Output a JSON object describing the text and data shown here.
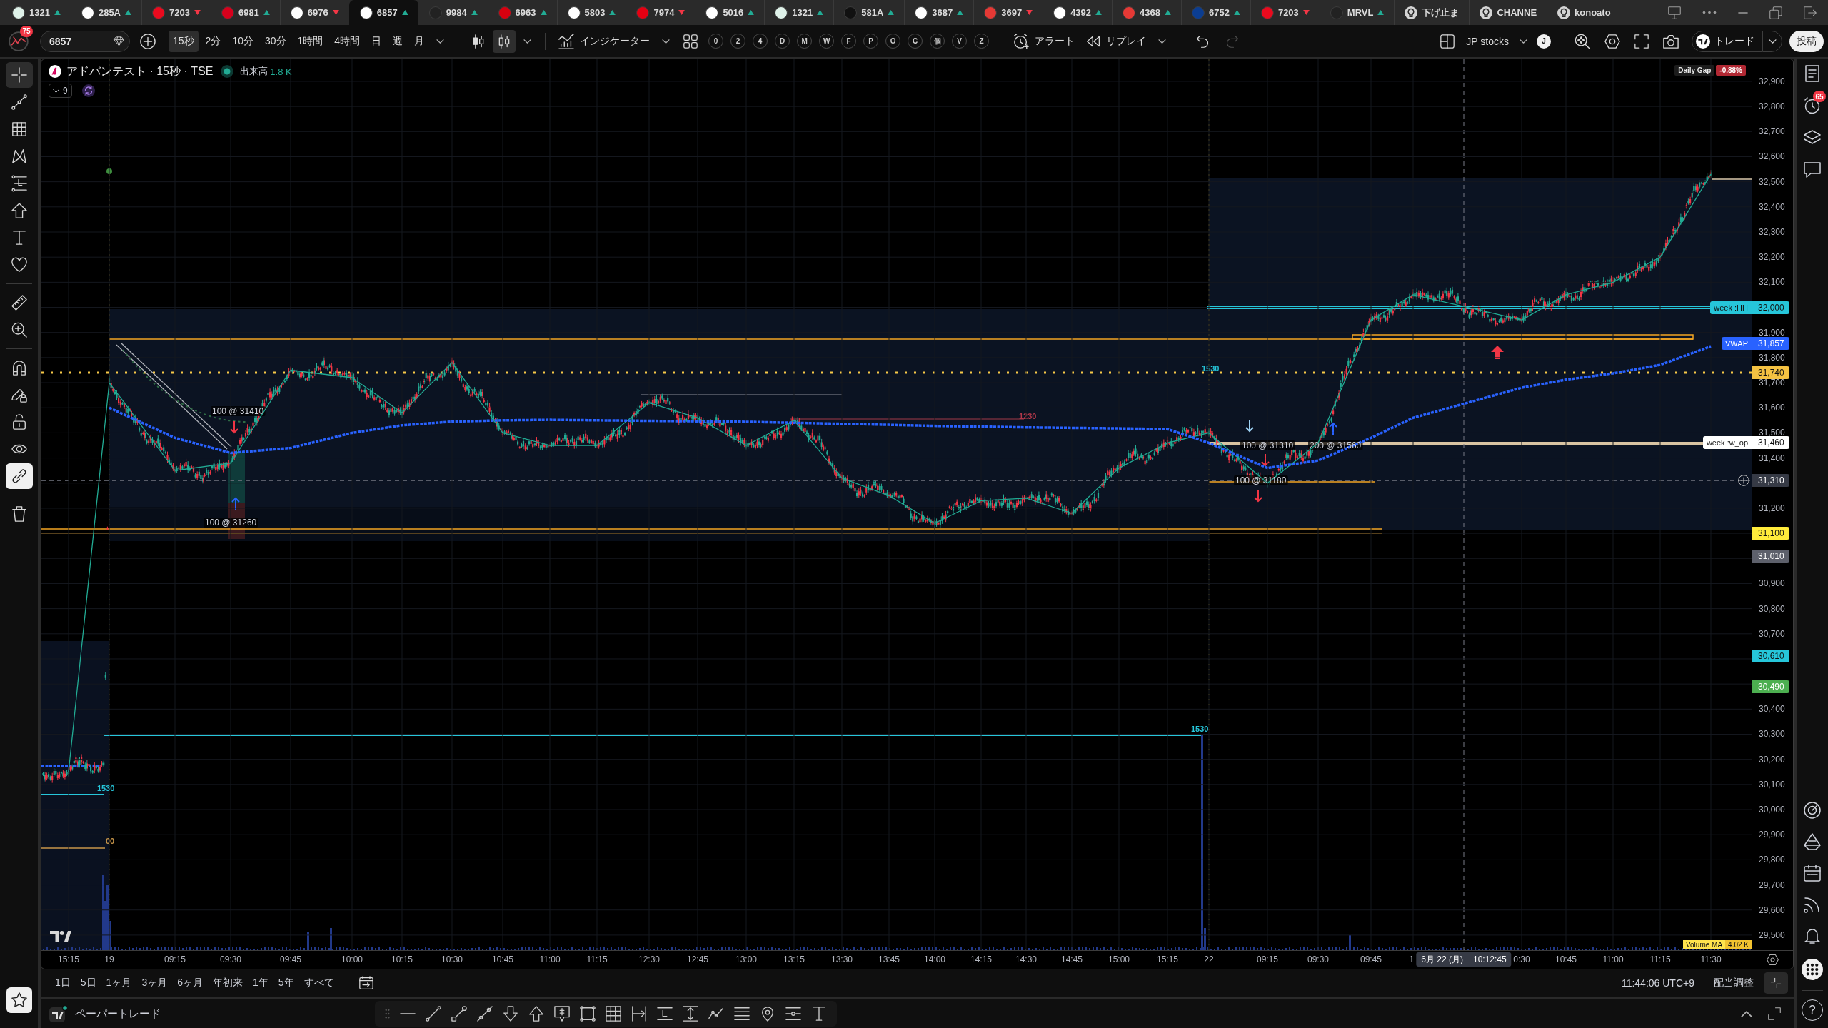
{
  "tabs": [
    {
      "kind": "symbol",
      "symbol": "1321",
      "color": "#dff2e9",
      "up": true,
      "selected": false
    },
    {
      "kind": "symbol",
      "symbol": "285A",
      "color": "#ffffff",
      "up": true,
      "selected": false
    },
    {
      "kind": "symbol",
      "symbol": "7203",
      "color": "#eb0a1e",
      "up": false,
      "selected": false
    },
    {
      "kind": "symbol",
      "symbol": "6981",
      "color": "#d6001c",
      "up": true,
      "selected": false
    },
    {
      "kind": "symbol",
      "symbol": "6976",
      "color": "#ffffff",
      "up": false,
      "selected": false
    },
    {
      "kind": "symbol",
      "symbol": "6857",
      "color": "#ffffff",
      "up": true,
      "selected": true
    },
    {
      "kind": "symbol",
      "symbol": "9984",
      "color": "#222222",
      "up": true,
      "selected": false
    },
    {
      "kind": "symbol",
      "symbol": "6963",
      "color": "#d7000f",
      "up": true,
      "selected": false
    },
    {
      "kind": "symbol",
      "symbol": "5803",
      "color": "#ffffff",
      "up": true,
      "selected": false
    },
    {
      "kind": "symbol",
      "symbol": "7974",
      "color": "#e60012",
      "up": false,
      "selected": false
    },
    {
      "kind": "symbol",
      "symbol": "5016",
      "color": "#ffffff",
      "up": true,
      "selected": false
    },
    {
      "kind": "symbol",
      "symbol": "1321",
      "color": "#dff2e9",
      "up": true,
      "selected": false
    },
    {
      "kind": "symbol",
      "symbol": "581A",
      "color": "#111111",
      "up": true,
      "selected": false
    },
    {
      "kind": "symbol",
      "symbol": "3687",
      "color": "#ffffff",
      "up": true,
      "selected": false
    },
    {
      "kind": "symbol",
      "symbol": "3697",
      "color": "#e53935",
      "up": false,
      "selected": false
    },
    {
      "kind": "symbol",
      "symbol": "4392",
      "color": "#ffffff",
      "up": true,
      "selected": false
    },
    {
      "kind": "symbol",
      "symbol": "4368",
      "color": "#e53935",
      "up": true,
      "selected": false
    },
    {
      "kind": "symbol",
      "symbol": "6752",
      "color": "#0b3d91",
      "up": true,
      "selected": false
    },
    {
      "kind": "symbol",
      "symbol": "7203",
      "color": "#eb0a1e",
      "up": false,
      "selected": false
    },
    {
      "kind": "symbol",
      "symbol": "MRVL",
      "color": "#222222",
      "up": true,
      "selected": false
    },
    {
      "kind": "idea",
      "symbol": "下げ止ま",
      "selected": false
    },
    {
      "kind": "idea",
      "symbol": "CHANNE",
      "selected": false
    },
    {
      "kind": "idea",
      "symbol": "konoato",
      "selected": false
    }
  ],
  "toolbar": {
    "notifications": "75",
    "symbol": "6857",
    "intervals": [
      {
        "label": "15秒",
        "selected": true
      },
      {
        "label": "2分",
        "selected": false
      },
      {
        "label": "10分",
        "selected": false
      },
      {
        "label": "30分",
        "selected": false
      },
      {
        "label": "1時間",
        "selected": false
      },
      {
        "label": "4時間",
        "selected": false
      },
      {
        "label": "日",
        "selected": false
      },
      {
        "label": "週",
        "selected": false
      },
      {
        "label": "月",
        "selected": false
      }
    ],
    "chart_styles": [
      {
        "kind": "candles",
        "selected": false
      },
      {
        "kind": "hollow-candles",
        "selected": true
      }
    ],
    "indicators": "インジケーター",
    "hotkeys": [
      "0",
      "2",
      "4",
      "D",
      "M",
      "W",
      "F",
      "P",
      "O",
      "C",
      "個",
      "V",
      "Z"
    ],
    "alert": "アラート",
    "replay": "リプレイ",
    "history": [
      {
        "kind": "undo",
        "disabled": false
      },
      {
        "kind": "redo",
        "disabled": true
      }
    ],
    "watchlist": "JP stocks",
    "account": "J",
    "trade": "トレード",
    "publish": "投稿"
  },
  "drawing_tools": [
    {
      "kind": "crosshair",
      "selected": true
    },
    {
      "kind": "trend-line",
      "selected": false
    },
    {
      "kind": "fib-grid",
      "selected": false
    },
    {
      "kind": "pattern",
      "selected": false
    },
    {
      "kind": "position",
      "selected": false
    },
    {
      "kind": "arrow",
      "selected": false
    },
    {
      "kind": "text",
      "selected": false
    },
    {
      "kind": "favorites",
      "selected": false
    },
    {
      "kind": "ruler",
      "selected": false
    },
    {
      "kind": "zoom-in",
      "selected": false
    }
  ],
  "toggles": [
    {
      "kind": "magnet",
      "on": false
    },
    {
      "kind": "draw-lock",
      "on": false
    },
    {
      "kind": "lock",
      "on": false
    },
    {
      "kind": "eye",
      "on": false
    },
    {
      "kind": "link",
      "on": true
    }
  ],
  "right_sidebar": {
    "alerts_badge": "65",
    "help": "?"
  },
  "chart": {
    "legend": {
      "title": "アドバンテスト · 15秒 · TSE",
      "volume_label": "出来高",
      "volume": "1.8 K",
      "hidden_count": "9"
    },
    "daily_gap": {
      "label": "Daily Gap",
      "value": "-0.88%"
    },
    "chart_data": {
      "type": "line",
      "grid": true,
      "categories": [
        "15:15",
        "19",
        "09:15",
        "09:30",
        "09:45",
        "10:00",
        "10:15",
        "10:30",
        "10:45",
        "11:00",
        "11:15",
        "12:30",
        "12:45",
        "13:00",
        "13:15",
        "13:30",
        "13:45",
        "14:00",
        "14:15",
        "14:30",
        "14:45",
        "15:00",
        "15:15",
        "22",
        "09:15",
        "09:30",
        "09:45",
        "1",
        "0:30",
        "10:45",
        "11:00",
        "11:15",
        "11:30"
      ],
      "series": [
        {
          "color": "#22ab94",
          "values": [
            30150,
            31700,
            31350,
            31380,
            31750,
            31720,
            31580,
            31780,
            31500,
            31450,
            31450,
            31620,
            31560,
            31450,
            31550,
            31320,
            31250,
            31140,
            31230,
            31240,
            31180,
            31360,
            31460,
            31500,
            31300,
            31460,
            31950,
            32050,
            31950,
            32050,
            32100,
            32200,
            32530
          ]
        },
        {
          "color": "#2962ff",
          "line_style": "dashed",
          "values": [
            null,
            31600,
            31480,
            31420,
            31440,
            31500,
            31530,
            31545,
            31550,
            31552,
            31550,
            31548,
            31546,
            31544,
            31540,
            31536,
            31532,
            31528,
            31525,
            31522,
            31520,
            31518,
            31515,
            31460,
            31360,
            31390,
            31480,
            31560,
            31680,
            31712,
            31737,
            31771,
            31845
          ]
        }
      ],
      "ylim": [
        29440,
        32988
      ],
      "yticks": [
        {
          "value": 32900,
          "label": "32,900"
        },
        {
          "value": 32800,
          "label": "32,800"
        },
        {
          "value": 32700,
          "label": "32,700"
        },
        {
          "value": 32600,
          "label": "32,600"
        },
        {
          "value": 32500,
          "label": "32,500"
        },
        {
          "value": 32400,
          "label": "32,400"
        },
        {
          "value": 32300,
          "label": "32,300"
        },
        {
          "value": 32200,
          "label": "32,200"
        },
        {
          "value": 32100,
          "label": "32,100"
        },
        {
          "value": 31900,
          "label": "31,900"
        },
        {
          "value": 31800,
          "label": "31,800"
        },
        {
          "value": 31700,
          "label": "31,700"
        },
        {
          "value": 31600,
          "label": "31,600"
        },
        {
          "value": 31500,
          "label": "31,500"
        },
        {
          "value": 31400,
          "label": "31,400"
        },
        {
          "value": 31200,
          "label": "31,200"
        },
        {
          "value": 30900,
          "label": "30,900"
        },
        {
          "value": 30800,
          "label": "30,800"
        },
        {
          "value": 30700,
          "label": "30,700"
        },
        {
          "value": 30400,
          "label": "30,400"
        },
        {
          "value": 30300,
          "label": "30,300"
        },
        {
          "value": 30200,
          "label": "30,200"
        },
        {
          "value": 30100,
          "label": "30,100"
        },
        {
          "value": 30000,
          "label": "30,000"
        },
        {
          "value": 29900,
          "label": "29,900"
        },
        {
          "value": 29800,
          "label": "29,800"
        },
        {
          "value": 29700,
          "label": "29,700"
        },
        {
          "value": 29600,
          "label": "29,600"
        },
        {
          "value": 29500,
          "label": "29,500"
        }
      ],
      "annotations": [
        {
          "text": "100 @ 31410"
        },
        {
          "text": "100 @ 31260"
        },
        {
          "text": "100 @ 31310"
        },
        {
          "text": "200 @ 31560"
        },
        {
          "text": "100 @ 31180"
        }
      ]
    },
    "level_labels": [
      {
        "text": "1530",
        "color": "#26c6da"
      },
      {
        "text": "1230",
        "color": "#b2384a"
      },
      {
        "text": "1530",
        "color": "#26c6da"
      },
      {
        "text": "1530",
        "color": "#26c6da"
      },
      {
        "text": "00",
        "color": "#c8964a"
      }
    ],
    "price_tags": [
      {
        "kind": "level",
        "text": "32,000",
        "label": "week :HH",
        "color": "#26c6da"
      },
      {
        "kind": "level",
        "text": "31,857",
        "label": "VWAP",
        "color": "#2962ff"
      },
      {
        "kind": "level",
        "text": "31,740",
        "color": "#f5c242"
      },
      {
        "kind": "level",
        "text": "31,460",
        "label": "week :w_op",
        "color": "#ffffff"
      },
      {
        "kind": "crosshair",
        "text": "31,310",
        "color": "#363a45"
      },
      {
        "kind": "level",
        "text": "31,100",
        "color": "#ffeb3b"
      },
      {
        "kind": "level",
        "text": "31,010",
        "color": "#5d606b"
      },
      {
        "kind": "level",
        "text": "30,610",
        "color": "#26c6da"
      },
      {
        "kind": "level",
        "text": "30,490",
        "color": "#4caf50"
      }
    ],
    "indicator_tag": {
      "name": "Volume MA",
      "value": "4.02 K"
    },
    "crosshair": {
      "date": "6月 22 (月)",
      "time": "10:12:45"
    }
  },
  "range_bar": {
    "ranges": [
      "1日",
      "5日",
      "1ヶ月",
      "3ヶ月",
      "6ヶ月",
      "年初来",
      "1年",
      "5年",
      "すべて"
    ],
    "clock": "11:44:06 UTC+9",
    "adjustment": "配当調整"
  },
  "bottom_panel": {
    "title": "ペーパートレード"
  }
}
